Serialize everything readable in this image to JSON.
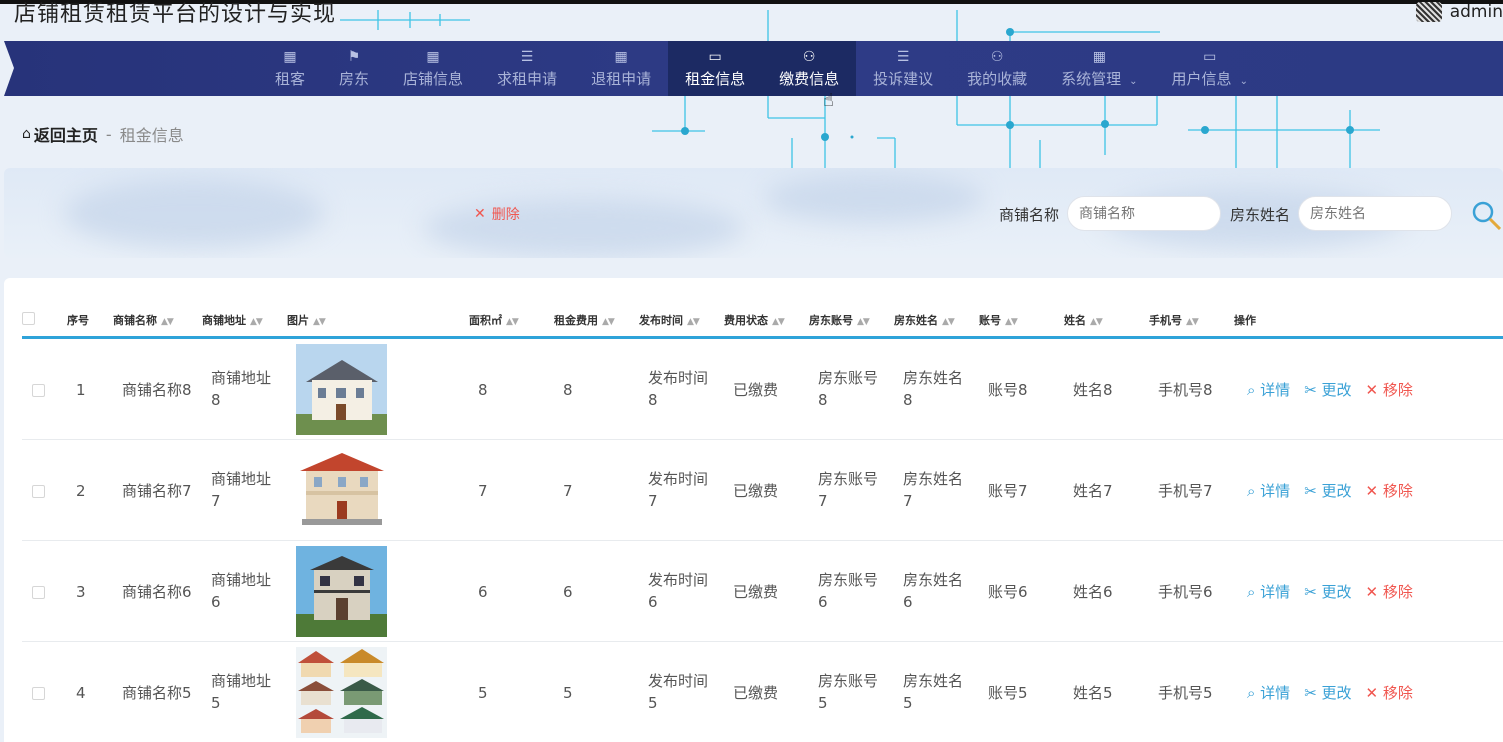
{
  "app": {
    "title": "店铺租赁租赁平台的设计与实现",
    "username": "admin"
  },
  "nav": {
    "items": [
      {
        "label": "租客",
        "icon": "▦"
      },
      {
        "label": "房东",
        "icon": "⚑"
      },
      {
        "label": "店铺信息",
        "icon": "▦"
      },
      {
        "label": "求租申请",
        "icon": "☰"
      },
      {
        "label": "退租申请",
        "icon": "▦"
      },
      {
        "label": "租金信息",
        "icon": "▭"
      },
      {
        "label": "缴费信息",
        "icon": "⚇"
      },
      {
        "label": "投诉建议",
        "icon": "☰"
      },
      {
        "label": "我的收藏",
        "icon": "⚇"
      },
      {
        "label": "系统管理",
        "icon": "▦"
      },
      {
        "label": "用户信息",
        "icon": "▭"
      }
    ],
    "caret": "⌄"
  },
  "breadcrumb": {
    "home": "返回主页",
    "separator": "-",
    "current": "租金信息"
  },
  "search": {
    "delete_label": "删除",
    "shop_name_label": "商铺名称",
    "shop_name_placeholder": "商铺名称",
    "landlord_name_label": "房东姓名",
    "landlord_name_placeholder": "房东姓名"
  },
  "table": {
    "columns": [
      "序号",
      "商铺名称",
      "商铺地址",
      "图片",
      "面积㎡",
      "租金费用",
      "发布时间",
      "费用状态",
      "房东账号",
      "房东姓名",
      "账号",
      "姓名",
      "手机号",
      "操作"
    ],
    "actions": {
      "view": "详情",
      "edit": "更改",
      "delete": "移除"
    },
    "rows": [
      {
        "index": "1",
        "shop_name": "商铺名称8",
        "address_a": "商铺地址",
        "address_b": "8",
        "area": "8",
        "rent": "8",
        "time_a": "发布时间",
        "time_b": "8",
        "status": "已缴费",
        "landlord_account_a": "房东账号",
        "landlord_account_b": "8",
        "landlord_name_a": "房东姓名",
        "landlord_name_b": "8",
        "account": "账号8",
        "name": "姓名8",
        "phone": "手机号8"
      },
      {
        "index": "2",
        "shop_name": "商铺名称7",
        "address_a": "商铺地址",
        "address_b": "7",
        "area": "7",
        "rent": "7",
        "time_a": "发布时间",
        "time_b": "7",
        "status": "已缴费",
        "landlord_account_a": "房东账号",
        "landlord_account_b": "7",
        "landlord_name_a": "房东姓名",
        "landlord_name_b": "7",
        "account": "账号7",
        "name": "姓名7",
        "phone": "手机号7"
      },
      {
        "index": "3",
        "shop_name": "商铺名称6",
        "address_a": "商铺地址",
        "address_b": "6",
        "area": "6",
        "rent": "6",
        "time_a": "发布时间",
        "time_b": "6",
        "status": "已缴费",
        "landlord_account_a": "房东账号",
        "landlord_account_b": "6",
        "landlord_name_a": "房东姓名",
        "landlord_name_b": "6",
        "account": "账号6",
        "name": "姓名6",
        "phone": "手机号6"
      },
      {
        "index": "4",
        "shop_name": "商铺名称5",
        "address_a": "商铺地址",
        "address_b": "5",
        "area": "5",
        "rent": "5",
        "time_a": "发布时间",
        "time_b": "5",
        "status": "已缴费",
        "landlord_account_a": "房东账号",
        "landlord_account_b": "5",
        "landlord_name_a": "房东姓名",
        "landlord_name_b": "5",
        "account": "账号5",
        "name": "姓名5",
        "phone": "手机号5"
      }
    ]
  },
  "colors": {
    "nav_bg": "#2c3a84",
    "nav_active": "#1c2a63",
    "accent_blue": "#2fa3d9",
    "danger_red": "#f0564f"
  }
}
